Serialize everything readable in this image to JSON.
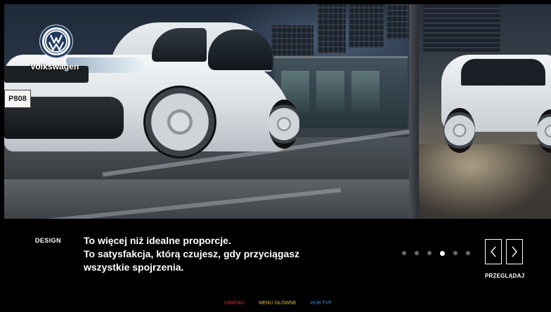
{
  "brand": {
    "name": "Volkswagen",
    "plate_text": "P808"
  },
  "slide": {
    "section": "DESIGN",
    "headline_lines": [
      "To więcej niż idealne proporcje.",
      "To satysfakcja, którą czujesz, gdy przyciągasz",
      "wszystkie spojrzenia."
    ],
    "total_slides": 6,
    "active_slide_index": 3
  },
  "navigation": {
    "prev_icon": "chevron-left-icon",
    "next_icon": "chevron-right-icon",
    "browse_label": "PRZEGLĄDAJ"
  },
  "footer": {
    "close_label": "ZAMKNIJ",
    "close_color": "#d9302c",
    "main_menu_label": "MENU GŁÓWNE",
    "main_menu_color": "#e2b73a",
    "hub_label": "HUB TVP",
    "hub_color": "#3f86d8"
  },
  "colors": {
    "background": "#000000",
    "text": "#ffffff",
    "inactive_dot": "#6a6a6a"
  }
}
